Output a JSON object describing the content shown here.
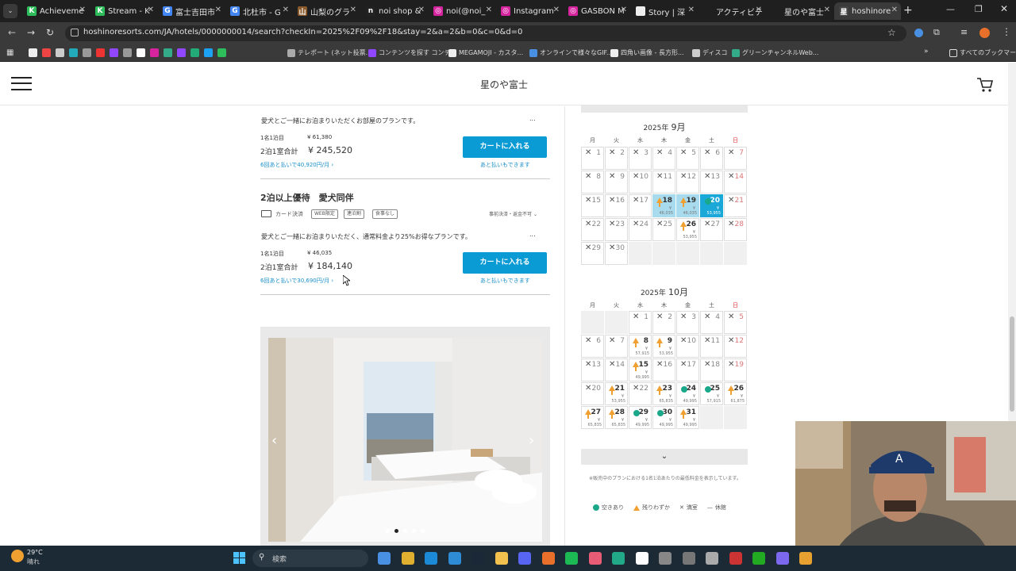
{
  "browser": {
    "tabs": [
      {
        "label": "Achieveme",
        "color": "#2ebd5b",
        "glyph": "K"
      },
      {
        "label": "Stream - K",
        "color": "#2ebd5b",
        "glyph": "K"
      },
      {
        "label": "富士吉田市",
        "color": "#4285f4",
        "glyph": "G"
      },
      {
        "label": "北杜市 - G",
        "color": "#4285f4",
        "glyph": "G"
      },
      {
        "label": "山梨のグラ",
        "color": "#8a5a2b",
        "glyph": "山"
      },
      {
        "label": "noi shop &",
        "color": "#222222",
        "glyph": "n"
      },
      {
        "label": "noi(@noi_",
        "color": "#d6249f",
        "glyph": "◎"
      },
      {
        "label": "Instagram",
        "color": "#d6249f",
        "glyph": "◎"
      },
      {
        "label": "GASBON M",
        "color": "#d6249f",
        "glyph": "◎"
      },
      {
        "label": "Story | 深",
        "color": "#eeeeee",
        "glyph": ""
      },
      {
        "label": "アクティビテ",
        "color": "#1f1f1f",
        "glyph": ""
      },
      {
        "label": "星のや富士",
        "color": "#1f1f1f",
        "glyph": ""
      },
      {
        "label": "hoshinore",
        "color": "#444444",
        "glyph": "星"
      }
    ],
    "url": "hoshinoresorts.com/JA/hotels/0000000014/search?checkIn=2025%2F09%2F18&stay=2&a=2&b=0&c=0&d=0",
    "bookmarks": [
      "テレポート (ネット投票...",
      "コンテンツを探す コンテ...",
      "MEGAMOJI - カスタ...",
      "オンラインで様々なGIF...",
      "四角い画像 - 長方形...",
      "ディスコ",
      "グリーンチャンネルWeb...",
      "すべてのブックマーク"
    ]
  },
  "site": {
    "title": "星のや富士"
  },
  "plans": [
    {
      "name": "",
      "description": "愛犬とご一緒にお泊まりいただくお部屋のプランです。",
      "per_night_label": "1名1泊目",
      "per_night_price": "¥ 61,380",
      "total_label": "2泊1室合計",
      "total_price": "¥ 245,520",
      "installment": "6回あと払いで40,920円/月 ›",
      "cart_label": "カートに入れる",
      "pay_later": "あと払いもできます",
      "more": "..."
    },
    {
      "name": "2泊以上優待　愛犬同伴",
      "card_label": "カード決済",
      "tags": [
        "WEB限定",
        "連泊割",
        "食事なし"
      ],
      "cancel_note": "事前決済・返金不可",
      "description": "愛犬とご一緒にお泊まりいただく、通常料金より25%お得なプランです。",
      "per_night_label": "1名1泊目",
      "per_night_price": "¥ 46,035",
      "total_label": "2泊1室合計",
      "total_price": "¥ 184,140",
      "installment": "6回あと払いで30,690円/月 ›",
      "cart_label": "カートに入れる",
      "pay_later": "あと払いもできます",
      "more": "..."
    }
  ],
  "gallery": {
    "active_dot": 1,
    "dot_count": 5
  },
  "calendar": {
    "weekdays": [
      "月",
      "火",
      "水",
      "木",
      "金",
      "土",
      "日"
    ],
    "september": {
      "year_label": "2025年",
      "month_label": "9月",
      "cells": [
        {
          "d": "1",
          "s": "x"
        },
        {
          "d": "2",
          "s": "x"
        },
        {
          "d": "3",
          "s": "x"
        },
        {
          "d": "4",
          "s": "x"
        },
        {
          "d": "5",
          "s": "x"
        },
        {
          "d": "6",
          "s": "x"
        },
        {
          "d": "7",
          "s": "x",
          "sun": true
        },
        {
          "d": "8",
          "s": "x"
        },
        {
          "d": "9",
          "s": "x"
        },
        {
          "d": "10",
          "s": "x"
        },
        {
          "d": "11",
          "s": "x"
        },
        {
          "d": "12",
          "s": "x"
        },
        {
          "d": "13",
          "s": "x"
        },
        {
          "d": "14",
          "s": "x",
          "sun": true
        },
        {
          "d": "15",
          "s": "x"
        },
        {
          "d": "16",
          "s": "x"
        },
        {
          "d": "17",
          "s": "x"
        },
        {
          "d": "18",
          "s": "few",
          "p": "46,035",
          "sel": "start"
        },
        {
          "d": "19",
          "s": "few",
          "p": "46,035",
          "sel": "mid"
        },
        {
          "d": "20",
          "s": "ok",
          "p": "53,955",
          "sel": "end"
        },
        {
          "d": "21",
          "s": "x",
          "sun": true
        },
        {
          "d": "22",
          "s": "x"
        },
        {
          "d": "23",
          "s": "x"
        },
        {
          "d": "24",
          "s": "x"
        },
        {
          "d": "25",
          "s": "x"
        },
        {
          "d": "26",
          "s": "few",
          "p": "53,955"
        },
        {
          "d": "27",
          "s": "x"
        },
        {
          "d": "28",
          "s": "x",
          "sun": true
        },
        {
          "d": "29",
          "s": "x"
        },
        {
          "d": "30",
          "s": "x"
        },
        {
          "s": "empty"
        },
        {
          "s": "empty"
        },
        {
          "s": "empty"
        },
        {
          "s": "empty"
        },
        {
          "s": "empty"
        }
      ]
    },
    "october": {
      "year_label": "2025年",
      "month_label": "10月",
      "cells": [
        {
          "s": "empty"
        },
        {
          "s": "empty"
        },
        {
          "d": "1",
          "s": "x"
        },
        {
          "d": "2",
          "s": "x"
        },
        {
          "d": "3",
          "s": "x"
        },
        {
          "d": "4",
          "s": "x"
        },
        {
          "d": "5",
          "s": "x",
          "sun": true
        },
        {
          "d": "6",
          "s": "x"
        },
        {
          "d": "7",
          "s": "x"
        },
        {
          "d": "8",
          "s": "few",
          "p": "57,915"
        },
        {
          "d": "9",
          "s": "few",
          "p": "53,955"
        },
        {
          "d": "10",
          "s": "x"
        },
        {
          "d": "11",
          "s": "x"
        },
        {
          "d": "12",
          "s": "x",
          "sun": true
        },
        {
          "d": "13",
          "s": "x"
        },
        {
          "d": "14",
          "s": "x"
        },
        {
          "d": "15",
          "s": "few",
          "p": "49,995"
        },
        {
          "d": "16",
          "s": "x"
        },
        {
          "d": "17",
          "s": "x"
        },
        {
          "d": "18",
          "s": "x"
        },
        {
          "d": "19",
          "s": "x",
          "sun": true
        },
        {
          "d": "20",
          "s": "x"
        },
        {
          "d": "21",
          "s": "few",
          "p": "53,955"
        },
        {
          "d": "22",
          "s": "x"
        },
        {
          "d": "23",
          "s": "few",
          "p": "65,835"
        },
        {
          "d": "24",
          "s": "ok",
          "p": "49,995"
        },
        {
          "d": "25",
          "s": "ok",
          "p": "57,915"
        },
        {
          "d": "26",
          "s": "few",
          "p": "61,875",
          "sun": true
        },
        {
          "d": "27",
          "s": "few",
          "p": "65,835"
        },
        {
          "d": "28",
          "s": "few",
          "p": "65,835"
        },
        {
          "d": "29",
          "s": "ok",
          "p": "49,995"
        },
        {
          "d": "30",
          "s": "ok",
          "p": "49,995"
        },
        {
          "d": "31",
          "s": "few",
          "p": "49,995"
        },
        {
          "s": "empty"
        },
        {
          "s": "empty"
        }
      ]
    },
    "note": "※販売中のプランにおける1名1泊あたりの最低料金を表示しています。",
    "legend": {
      "ok": "空きあり",
      "few": "残りわずか",
      "full": "満室",
      "closed": "休館"
    }
  },
  "taskbar": {
    "temp": "29°C",
    "weather": "晴れ",
    "search_placeholder": "検索"
  }
}
